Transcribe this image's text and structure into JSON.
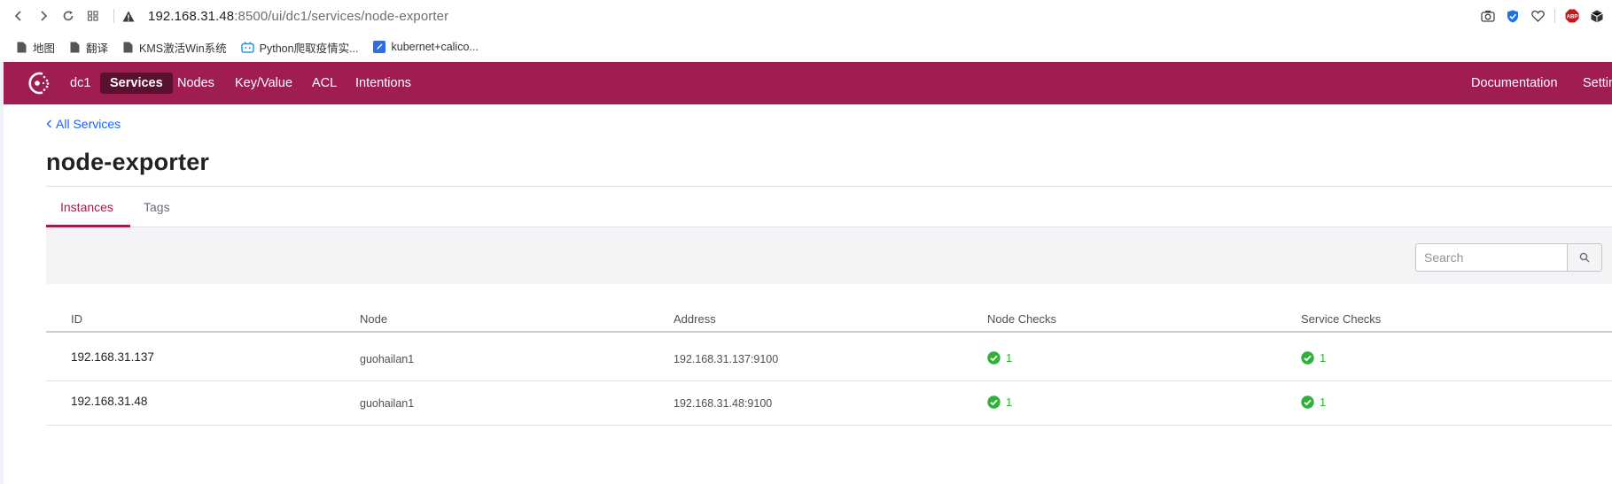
{
  "browser": {
    "url_host": "192.168.31.48",
    "url_path": ":8500/ui/dc1/services/node-exporter",
    "bookmarks": [
      {
        "label": "地图",
        "icon": "page-icon"
      },
      {
        "label": "翻译",
        "icon": "page-icon"
      },
      {
        "label": "KMS激活Win系统",
        "icon": "page-icon"
      },
      {
        "label": "Python爬取疫情实...",
        "icon": "bilibili-icon"
      },
      {
        "label": "kubernet+calico...",
        "icon": "pen-icon"
      }
    ]
  },
  "nav": {
    "datacenter": "dc1",
    "items": [
      {
        "label": "Services",
        "active": true
      },
      {
        "label": "Nodes",
        "active": false
      },
      {
        "label": "Key/Value",
        "active": false
      },
      {
        "label": "ACL",
        "active": false
      },
      {
        "label": "Intentions",
        "active": false
      }
    ],
    "right_items": [
      "Documentation",
      "Settings"
    ],
    "bg_color": "#a01d52"
  },
  "page": {
    "back_label": "All Services",
    "title": "node-exporter",
    "tabs": [
      "Instances",
      "Tags"
    ],
    "active_tab": "Instances"
  },
  "search": {
    "placeholder": "Search"
  },
  "table": {
    "headers": [
      "ID",
      "Node",
      "Address",
      "Node Checks",
      "Service Checks"
    ],
    "rows": [
      {
        "id": "192.168.31.137",
        "node": "guohailan1",
        "address": "192.168.31.137:9100",
        "node_checks": "1",
        "service_checks": "1"
      },
      {
        "id": "192.168.31.48",
        "node": "guohailan1",
        "address": "192.168.31.48:9100",
        "node_checks": "1",
        "service_checks": "1"
      }
    ]
  },
  "colors": {
    "accent": "#a01d52",
    "link": "#1563ff",
    "passing": "#2eb039"
  }
}
